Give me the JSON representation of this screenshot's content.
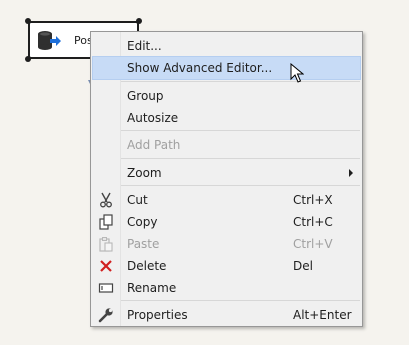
{
  "component": {
    "label": "Post",
    "icon": "destination-db-icon"
  },
  "menu": {
    "items": [
      {
        "label": "Edit...",
        "shortcut": "",
        "icon": ""
      },
      {
        "label": "Show Advanced Editor...",
        "shortcut": "",
        "icon": ""
      },
      {
        "label": "Group",
        "shortcut": "",
        "icon": ""
      },
      {
        "label": "Autosize",
        "shortcut": "",
        "icon": ""
      },
      {
        "label": "Add Path",
        "shortcut": "",
        "icon": ""
      },
      {
        "label": "Zoom",
        "shortcut": "",
        "icon": ""
      },
      {
        "label": "Cut",
        "shortcut": "Ctrl+X",
        "icon": "scissors-icon"
      },
      {
        "label": "Copy",
        "shortcut": "Ctrl+C",
        "icon": "copy-icon"
      },
      {
        "label": "Paste",
        "shortcut": "Ctrl+V",
        "icon": "paste-icon"
      },
      {
        "label": "Delete",
        "shortcut": "Del",
        "icon": "delete-x-icon"
      },
      {
        "label": "Rename",
        "shortcut": "",
        "icon": "rename-icon"
      },
      {
        "label": "Properties",
        "shortcut": "Alt+Enter",
        "icon": "wrench-icon"
      }
    ]
  },
  "colors": {
    "background": "#f5f3ee",
    "menu_bg": "#f0f0f0",
    "highlight": "#c7dbf6",
    "disabled_text": "#a0a0a0",
    "delete_icon": "#d01f1f",
    "db_icon": "#2f2f2f",
    "arrow_blue": "#1e6fd9"
  }
}
